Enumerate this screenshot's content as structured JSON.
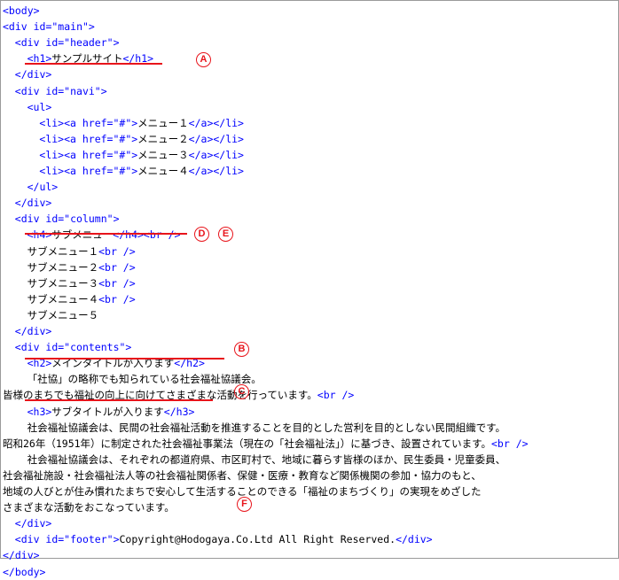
{
  "lines": [
    {
      "indent": 0,
      "parts": [
        {
          "k": "tag",
          "t": "<body>"
        }
      ]
    },
    {
      "indent": 0,
      "parts": [
        {
          "k": "tag",
          "t": "<div id=\"main\">"
        }
      ]
    },
    {
      "indent": 2,
      "parts": [
        {
          "k": "tag",
          "t": "<div id=\"header\">"
        }
      ]
    },
    {
      "indent": 4,
      "parts": [
        {
          "k": "tag",
          "t": "<h1>"
        },
        {
          "k": "txt",
          "t": "サンプルサイト"
        },
        {
          "k": "tag",
          "t": "</h1>"
        }
      ]
    },
    {
      "indent": 2,
      "parts": [
        {
          "k": "tag",
          "t": "</div>"
        }
      ]
    },
    {
      "indent": 2,
      "parts": [
        {
          "k": "tag",
          "t": "<div id=\"navi\">"
        }
      ]
    },
    {
      "indent": 4,
      "parts": [
        {
          "k": "tag",
          "t": "<ul>"
        }
      ]
    },
    {
      "indent": 6,
      "parts": [
        {
          "k": "tag",
          "t": "<li><a href=\"#\">"
        },
        {
          "k": "txt",
          "t": "メニュー１"
        },
        {
          "k": "tag",
          "t": "</a></li>"
        }
      ]
    },
    {
      "indent": 6,
      "parts": [
        {
          "k": "tag",
          "t": "<li><a href=\"#\">"
        },
        {
          "k": "txt",
          "t": "メニュー２"
        },
        {
          "k": "tag",
          "t": "</a></li>"
        }
      ]
    },
    {
      "indent": 6,
      "parts": [
        {
          "k": "tag",
          "t": "<li><a href=\"#\">"
        },
        {
          "k": "txt",
          "t": "メニュー３"
        },
        {
          "k": "tag",
          "t": "</a></li>"
        }
      ]
    },
    {
      "indent": 6,
      "parts": [
        {
          "k": "tag",
          "t": "<li><a href=\"#\">"
        },
        {
          "k": "txt",
          "t": "メニュー４"
        },
        {
          "k": "tag",
          "t": "</a></li>"
        }
      ]
    },
    {
      "indent": 4,
      "parts": [
        {
          "k": "tag",
          "t": "</ul>"
        }
      ]
    },
    {
      "indent": 2,
      "parts": [
        {
          "k": "tag",
          "t": "</div>"
        }
      ]
    },
    {
      "indent": 2,
      "parts": [
        {
          "k": "tag",
          "t": "<div id=\"column\">"
        }
      ]
    },
    {
      "indent": 4,
      "parts": [
        {
          "k": "tag",
          "t": "<h4>"
        },
        {
          "k": "txt",
          "t": "サブメニュー"
        },
        {
          "k": "tag",
          "t": "</h4><br />"
        }
      ]
    },
    {
      "indent": 4,
      "parts": [
        {
          "k": "txt",
          "t": "サブメニュー１"
        },
        {
          "k": "tag",
          "t": "<br />"
        }
      ]
    },
    {
      "indent": 4,
      "parts": [
        {
          "k": "txt",
          "t": "サブメニュー２"
        },
        {
          "k": "tag",
          "t": "<br />"
        }
      ]
    },
    {
      "indent": 4,
      "parts": [
        {
          "k": "txt",
          "t": "サブメニュー３"
        },
        {
          "k": "tag",
          "t": "<br />"
        }
      ]
    },
    {
      "indent": 4,
      "parts": [
        {
          "k": "txt",
          "t": "サブメニュー４"
        },
        {
          "k": "tag",
          "t": "<br />"
        }
      ]
    },
    {
      "indent": 4,
      "parts": [
        {
          "k": "txt",
          "t": "サブメニュー５"
        }
      ]
    },
    {
      "indent": 2,
      "parts": [
        {
          "k": "tag",
          "t": "</div>"
        }
      ]
    },
    {
      "indent": 2,
      "parts": [
        {
          "k": "tag",
          "t": "<div id=\"contents\">"
        }
      ]
    },
    {
      "indent": 4,
      "parts": [
        {
          "k": "tag",
          "t": "<h2>"
        },
        {
          "k": "txt",
          "t": "メインタイトルが入ります"
        },
        {
          "k": "tag",
          "t": "</h2>"
        }
      ]
    },
    {
      "indent": 4,
      "parts": [
        {
          "k": "txt",
          "t": "「社協」の略称でも知られている社会福祉協議会。"
        }
      ]
    },
    {
      "indent": 0,
      "parts": [
        {
          "k": "txt",
          "t": "皆様のまちでも福祉の向上に向けてさまざまな活動を行っています。"
        },
        {
          "k": "tag",
          "t": "<br />"
        }
      ]
    },
    {
      "indent": 4,
      "parts": [
        {
          "k": "tag",
          "t": "<h3>"
        },
        {
          "k": "txt",
          "t": "サブタイトルが入ります"
        },
        {
          "k": "tag",
          "t": "</h3>"
        }
      ]
    },
    {
      "indent": 4,
      "parts": [
        {
          "k": "txt",
          "t": "社会福祉協議会は、民間の社会福祉活動を推進することを目的とした営利を目的としない民間組織です。"
        }
      ]
    },
    {
      "indent": 0,
      "parts": [
        {
          "k": "txt",
          "t": "昭和26年（1951年）に制定された社会福祉事業法（現在の「社会福祉法」）に基づき、設置されています。"
        },
        {
          "k": "tag",
          "t": "<br />"
        }
      ]
    },
    {
      "indent": 4,
      "parts": [
        {
          "k": "txt",
          "t": "社会福祉協議会は、それぞれの都道府県、市区町村で、地域に暮らす皆様のほか、民生委員・児童委員、"
        }
      ]
    },
    {
      "indent": 0,
      "parts": [
        {
          "k": "txt",
          "t": "社会福祉施設・社会福祉法人等の社会福祉関係者、保健・医療・教育など関係機関の参加・協力のもと、"
        }
      ]
    },
    {
      "indent": 0,
      "parts": [
        {
          "k": "txt",
          "t": "地域の人びとが住み慣れたまちで安心して生活することのできる「福祉のまちづくり」の実現をめざした"
        }
      ]
    },
    {
      "indent": 0,
      "parts": [
        {
          "k": "txt",
          "t": "さまざまな活動をおこなっています。"
        }
      ]
    },
    {
      "indent": 2,
      "parts": [
        {
          "k": "tag",
          "t": "</div>"
        }
      ]
    },
    {
      "indent": 2,
      "parts": [
        {
          "k": "tag",
          "t": "<div id=\"footer\">"
        },
        {
          "k": "txt",
          "t": "Copyright@Hodogaya.Co.Ltd All Right Reserved."
        },
        {
          "k": "tag",
          "t": "</div>"
        }
      ]
    },
    {
      "indent": 0,
      "parts": [
        {
          "k": "tag",
          "t": "</div>"
        }
      ]
    },
    {
      "indent": 0,
      "parts": [
        {
          "k": "tag",
          "t": "</body>"
        }
      ]
    }
  ],
  "markers": {
    "a": "A",
    "b": "B",
    "c": "C",
    "d": "D",
    "e": "E",
    "f": "F"
  },
  "colors": {
    "tag": "#0000ff",
    "text": "#000000",
    "annotation": "#e8141b"
  }
}
